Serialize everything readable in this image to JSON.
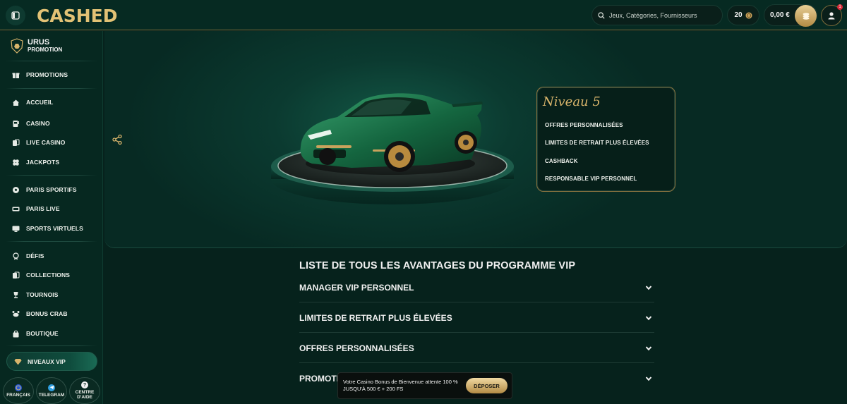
{
  "header": {
    "logo": "CASHED",
    "search_placeholder": "Jeux, Catégories, Fournisseurs",
    "coins": "20",
    "balance": "0,00 €",
    "notification_count": "1"
  },
  "sidebar": {
    "promo": {
      "title": "URUS",
      "subtitle": "PROMOTION"
    },
    "items": [
      {
        "label": "PROMOTIONS",
        "icon": "gift-icon"
      },
      {
        "label": "ACCUEIL",
        "icon": "home-icon"
      },
      {
        "label": "CASINO",
        "icon": "slot-machine-icon"
      },
      {
        "label": "LIVE CASINO",
        "icon": "cards-icon"
      },
      {
        "label": "JACKPOTS",
        "icon": "clover-icon"
      },
      {
        "label": "PARIS SPORTIFS",
        "icon": "soccer-icon"
      },
      {
        "label": "PARIS LIVE",
        "icon": "live-icon"
      },
      {
        "label": "SPORTS VIRTUELS",
        "icon": "monitor-icon"
      },
      {
        "label": "DÉFIS",
        "icon": "medal-icon"
      },
      {
        "label": "COLLECTIONS",
        "icon": "collections-icon"
      },
      {
        "label": "TOURNOIS",
        "icon": "trophy-icon"
      },
      {
        "label": "BONUS CRAB",
        "icon": "crab-icon"
      },
      {
        "label": "BOUTIQUE",
        "icon": "bag-icon"
      }
    ],
    "vip_label": "NIVEAUX VIP",
    "bottom": [
      {
        "label": "FRANÇAIS",
        "icon": "globe-icon"
      },
      {
        "label": "TELEGRAM",
        "icon": "telegram-icon"
      },
      {
        "label": "CENTRE D'AIDE",
        "icon": "help-icon"
      }
    ]
  },
  "hero": {
    "level_title": "Niveau 5",
    "perks": [
      "OFFRES PERSONNALISÉES",
      "LIMITES DE RETRAIT PLUS ÉLEVÉES",
      "CASHBACK",
      "RESPONSABLE VIP PERSONNEL"
    ]
  },
  "vip_list": {
    "title": "LISTE DE TOUS LES AVANTAGES DU PROGRAMME VIP",
    "items": [
      "MANAGER VIP PERSONNEL",
      "LIMITES DE RETRAIT PLUS ÉLEVÉES",
      "OFFRES PERSONNALISÉES",
      "PROMOTI"
    ]
  },
  "toast": {
    "message_line1": "Votre Casino Bonus de Bienvenue attente 100 %",
    "message_line2": "JUSQU'À 500 € + 200 FS",
    "button": "DÉPOSER"
  },
  "colors": {
    "background": "#06221c",
    "gold": "#d8b46b",
    "accent": "#0f4c3d"
  }
}
